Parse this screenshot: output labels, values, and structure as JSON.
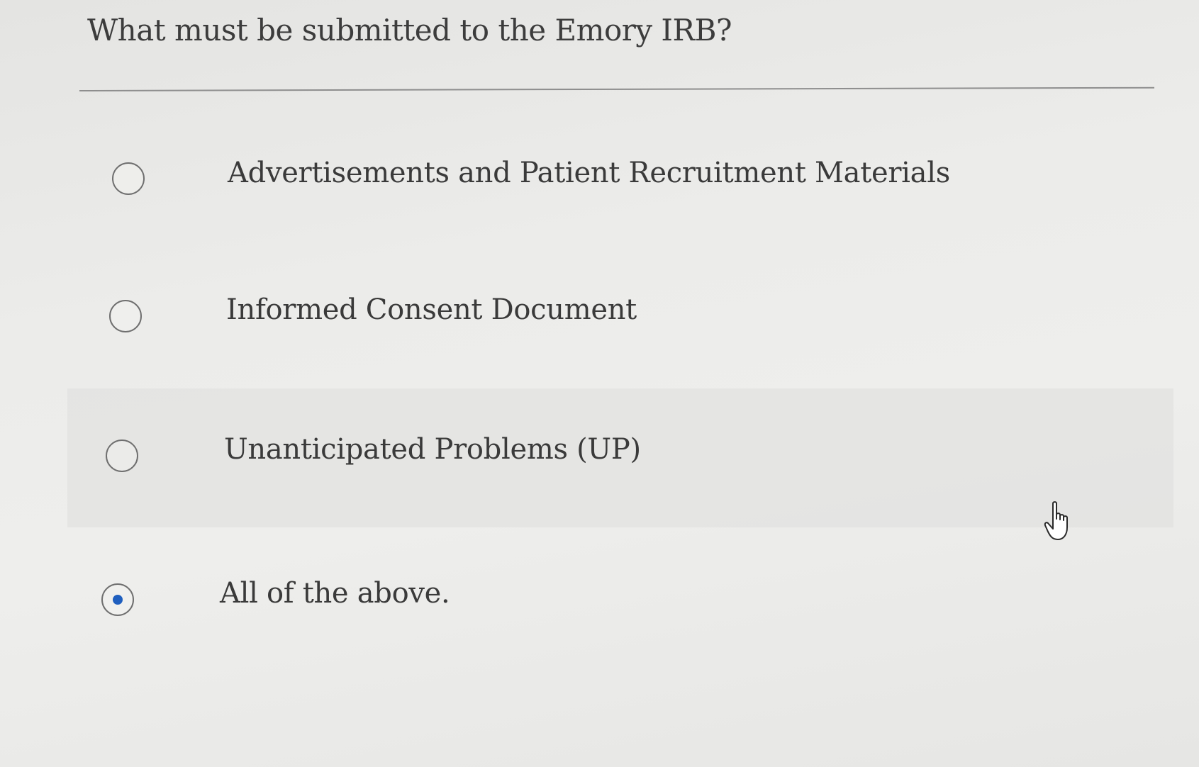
{
  "question": {
    "text": "What must be submitted to the Emory IRB?"
  },
  "options": [
    {
      "label": "Advertisements and Patient Recruitment Materials",
      "selected": false
    },
    {
      "label": "Informed Consent Document",
      "selected": false
    },
    {
      "label": "Unanticipated Problems (UP)",
      "selected": false
    },
    {
      "label": "All of the above.",
      "selected": true
    }
  ],
  "colors": {
    "selected_dot": "#1f5fbf",
    "radio_border": "#6f6f6f",
    "text": "#3a3a3a"
  },
  "icons": {
    "cursor": "hand-pointer-icon"
  }
}
